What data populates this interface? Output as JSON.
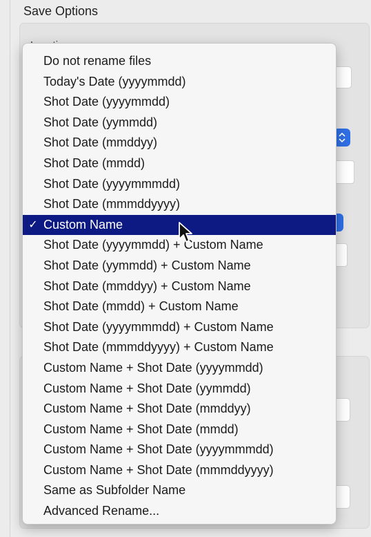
{
  "window": {
    "section_title": "Save Options",
    "group_label": "Location"
  },
  "menu": {
    "check_glyph": "✓",
    "selected_index": 8,
    "items": [
      {
        "label": "Do not rename files",
        "checked": false
      },
      {
        "label": "Today's Date (yyyymmdd)",
        "checked": false
      },
      {
        "label": "Shot Date (yyyymmdd)",
        "checked": false
      },
      {
        "label": "Shot Date (yymmdd)",
        "checked": false
      },
      {
        "label": "Shot Date (mmddyy)",
        "checked": false
      },
      {
        "label": "Shot Date (mmdd)",
        "checked": false
      },
      {
        "label": "Shot Date (yyyymmmdd)",
        "checked": false
      },
      {
        "label": "Shot Date (mmmddyyyy)",
        "checked": false
      },
      {
        "label": "Custom Name",
        "checked": true
      },
      {
        "label": "Shot Date (yyyymmdd) + Custom Name",
        "checked": false
      },
      {
        "label": "Shot Date (yymmdd) + Custom Name",
        "checked": false
      },
      {
        "label": "Shot Date (mmddyy) + Custom Name",
        "checked": false
      },
      {
        "label": "Shot Date (mmdd) + Custom Name",
        "checked": false
      },
      {
        "label": "Shot Date (yyyymmmdd) + Custom Name",
        "checked": false
      },
      {
        "label": "Shot Date (mmmddyyyy) + Custom Name",
        "checked": false
      },
      {
        "label": "Custom Name + Shot Date (yyyymmdd)",
        "checked": false
      },
      {
        "label": "Custom Name + Shot Date (yymmdd)",
        "checked": false
      },
      {
        "label": "Custom Name + Shot Date (mmddyy)",
        "checked": false
      },
      {
        "label": "Custom Name + Shot Date (mmdd)",
        "checked": false
      },
      {
        "label": "Custom Name + Shot Date (yyyymmmdd)",
        "checked": false
      },
      {
        "label": "Custom Name + Shot Date (mmmddyyyy)",
        "checked": false
      },
      {
        "label": "Same as Subfolder Name",
        "checked": false
      },
      {
        "label": "Advanced Rename...",
        "checked": false
      }
    ]
  },
  "colors": {
    "selection": "#0e1a84",
    "accent_blue": "#2f6fe5"
  },
  "icons": {
    "stepper": "up-down-stepper-icon",
    "cursor": "mouse-pointer-icon"
  }
}
